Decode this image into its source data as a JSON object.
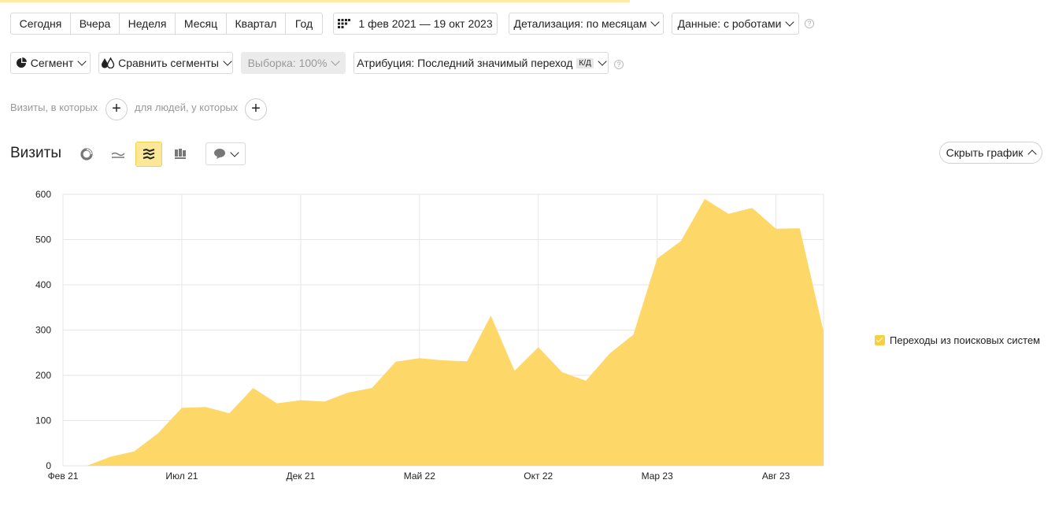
{
  "periods": [
    "Сегодня",
    "Вчера",
    "Неделя",
    "Месяц",
    "Квартал",
    "Год"
  ],
  "date_range": "1 фев 2021 — 19 окт 2023",
  "detail": "Детализация: по месяцам",
  "data_mode": "Данные: с роботами",
  "segment": "Сегмент",
  "compare": "Сравнить сегменты",
  "sample": "Выборка: 100%",
  "attribution": "Атрибуция: Последний значимый переход",
  "attribution_badge": "К/Д",
  "filter": {
    "visits_label": "Визиты, в которых",
    "people_label": "для людей, у которых"
  },
  "help_mark": "?",
  "plus": "+",
  "chart_title": "Визиты",
  "hide_chart": "Скрыть график",
  "colors": {
    "area": "#fdd868",
    "accent": "#f7cf45",
    "grid": "#e6e6e6"
  },
  "icons": [
    "pie-chart-icon",
    "line-chart-icon",
    "area-chart-icon",
    "bar-chart-icon",
    "comment-icon"
  ],
  "chart_data": {
    "type": "area",
    "ylim": [
      0,
      600
    ],
    "yticks": [
      0,
      100,
      200,
      300,
      400,
      500,
      600
    ],
    "xticks": [
      {
        "label": "Фев 21",
        "index": 0
      },
      {
        "label": "Июл 21",
        "index": 5
      },
      {
        "label": "Дек 21",
        "index": 10
      },
      {
        "label": "Май 22",
        "index": 15
      },
      {
        "label": "Окт 22",
        "index": 20
      },
      {
        "label": "Мар 23",
        "index": 25
      },
      {
        "label": "Авг 23",
        "index": 30
      }
    ],
    "x": [
      "2021-02",
      "2021-03",
      "2021-04",
      "2021-05",
      "2021-06",
      "2021-07",
      "2021-08",
      "2021-09",
      "2021-10",
      "2021-11",
      "2021-12",
      "2022-01",
      "2022-02",
      "2022-03",
      "2022-04",
      "2022-05",
      "2022-06",
      "2022-07",
      "2022-08",
      "2022-09",
      "2022-10",
      "2022-11",
      "2022-12",
      "2023-01",
      "2023-02",
      "2023-03",
      "2023-04",
      "2023-05",
      "2023-06",
      "2023-07",
      "2023-08",
      "2023-09",
      "2023-10"
    ],
    "series": [
      {
        "name": "Переходы из поисковых систем",
        "values": [
          0,
          0,
          20,
          32,
          72,
          128,
          130,
          116,
          172,
          138,
          145,
          142,
          162,
          172,
          230,
          238,
          233,
          231,
          332,
          210,
          262,
          207,
          188,
          248,
          290,
          458,
          497,
          590,
          557,
          570,
          524,
          525,
          297
        ]
      }
    ],
    "grid": true,
    "legend": "right"
  }
}
